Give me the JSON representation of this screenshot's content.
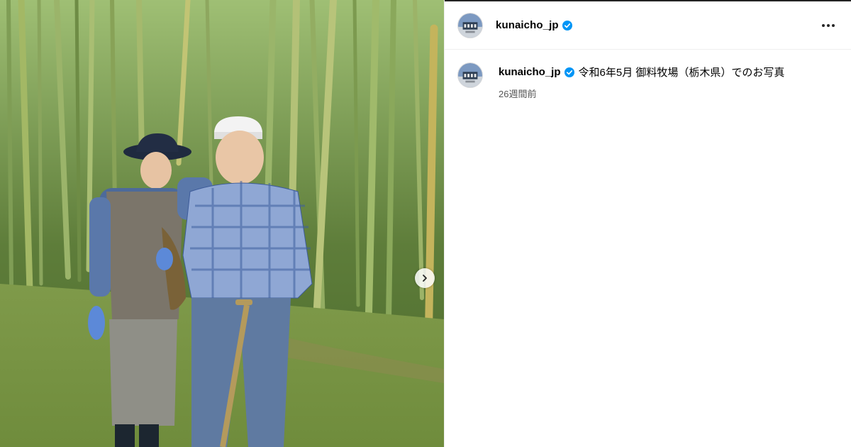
{
  "post": {
    "username": "kunaicho_jp",
    "caption": "令和6年5月 御料牧場（栃木県）でのお写真",
    "time_ago": "26週間前",
    "verified_color": "#0095f6"
  },
  "photo": {
    "subject": "bamboo-grove-photo"
  },
  "controls": {
    "next_icon": "chevron-right-icon",
    "more_icon": "more-horizontal-icon"
  }
}
